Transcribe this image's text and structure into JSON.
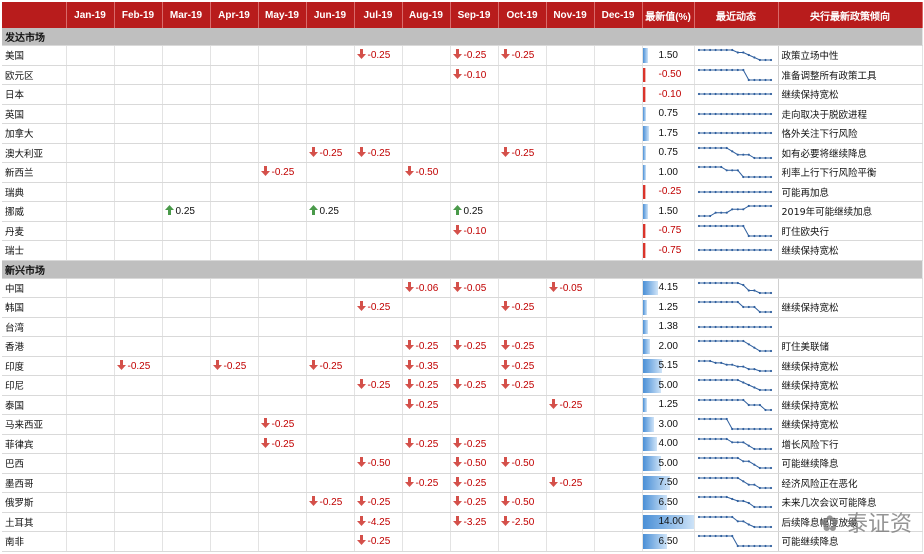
{
  "header": {
    "country": "",
    "months": [
      "Jan-19",
      "Feb-19",
      "Mar-19",
      "Apr-19",
      "May-19",
      "Jun-19",
      "Jul-19",
      "Aug-19",
      "Sep-19",
      "Oct-19",
      "Nov-19",
      "Dec-19"
    ],
    "latest": "最新值(%)",
    "trend": "最近动态",
    "note": "央行最新政策倾向"
  },
  "sections": [
    {
      "title": "发达市场",
      "rows": [
        {
          "country": "美国",
          "chg": {
            "Jul-19": "-0.25",
            "Sep-19": "-0.25",
            "Oct-19": "-0.25"
          },
          "latest": "1.50",
          "latest_num": 1.5,
          "note": "政策立场中性",
          "trend": [
            2.5,
            2.5,
            2.5,
            2.5,
            2.5,
            2.5,
            2.5,
            2.25,
            2.25,
            2.0,
            1.75,
            1.5,
            1.5,
            1.5
          ]
        },
        {
          "country": "欧元区",
          "chg": {
            "Sep-19": "-0.10"
          },
          "latest": "-0.50",
          "latest_num": -0.5,
          "note": "准备调整所有政策工具",
          "trend": [
            -0.4,
            -0.4,
            -0.4,
            -0.4,
            -0.4,
            -0.4,
            -0.4,
            -0.4,
            -0.4,
            -0.5,
            -0.5,
            -0.5,
            -0.5,
            -0.5
          ]
        },
        {
          "country": "日本",
          "chg": {},
          "latest": "-0.10",
          "latest_num": -0.1,
          "note": "继续保持宽松",
          "trend": [
            -0.1,
            -0.1,
            -0.1,
            -0.1,
            -0.1,
            -0.1,
            -0.1,
            -0.1,
            -0.1,
            -0.1,
            -0.1,
            -0.1,
            -0.1,
            -0.1
          ]
        },
        {
          "country": "英国",
          "chg": {},
          "latest": "0.75",
          "latest_num": 0.75,
          "note": "走向取决于脱欧进程",
          "trend": [
            0.75,
            0.75,
            0.75,
            0.75,
            0.75,
            0.75,
            0.75,
            0.75,
            0.75,
            0.75,
            0.75,
            0.75,
            0.75,
            0.75
          ]
        },
        {
          "country": "加拿大",
          "chg": {},
          "latest": "1.75",
          "latest_num": 1.75,
          "note": "恪外关注下行风险",
          "trend": [
            1.75,
            1.75,
            1.75,
            1.75,
            1.75,
            1.75,
            1.75,
            1.75,
            1.75,
            1.75,
            1.75,
            1.75,
            1.75,
            1.75
          ]
        },
        {
          "country": "澳大利亚",
          "chg": {
            "Jun-19": "-0.25",
            "Jul-19": "-0.25",
            "Oct-19": "-0.25"
          },
          "latest": "0.75",
          "latest_num": 0.75,
          "note": "如有必要将继续降息",
          "trend": [
            1.5,
            1.5,
            1.5,
            1.5,
            1.5,
            1.5,
            1.25,
            1.0,
            1.0,
            1.0,
            0.75,
            0.75,
            0.75,
            0.75
          ]
        },
        {
          "country": "新西兰",
          "chg": {
            "May-19": "-0.25",
            "Aug-19": "-0.50"
          },
          "latest": "1.00",
          "latest_num": 1.0,
          "note": "利率上行下行风险平衡",
          "trend": [
            1.75,
            1.75,
            1.75,
            1.75,
            1.75,
            1.5,
            1.5,
            1.5,
            1.0,
            1.0,
            1.0,
            1.0,
            1.0,
            1.0
          ]
        },
        {
          "country": "瑞典",
          "chg": {},
          "latest": "-0.25",
          "latest_num": -0.25,
          "note": "可能再加息",
          "trend": [
            -0.25,
            -0.25,
            -0.25,
            -0.25,
            -0.25,
            -0.25,
            -0.25,
            -0.25,
            -0.25,
            -0.25,
            -0.25,
            -0.25,
            -0.25,
            -0.25
          ]
        },
        {
          "country": "挪威",
          "chg": {
            "Mar-19": "0.25",
            "Jun-19": "0.25",
            "Sep-19": "0.25"
          },
          "latest": "1.50",
          "latest_num": 1.5,
          "note": "2019年可能继续加息",
          "trend": [
            0.75,
            0.75,
            0.75,
            1.0,
            1.0,
            1.0,
            1.25,
            1.25,
            1.25,
            1.5,
            1.5,
            1.5,
            1.5,
            1.5
          ]
        },
        {
          "country": "丹麦",
          "chg": {
            "Sep-19": "-0.10"
          },
          "latest": "-0.75",
          "latest_num": -0.75,
          "note": "盯住欧央行",
          "trend": [
            -0.65,
            -0.65,
            -0.65,
            -0.65,
            -0.65,
            -0.65,
            -0.65,
            -0.65,
            -0.65,
            -0.75,
            -0.75,
            -0.75,
            -0.75,
            -0.75
          ]
        },
        {
          "country": "瑞士",
          "chg": {},
          "latest": "-0.75",
          "latest_num": -0.75,
          "note": "继续保持宽松",
          "trend": [
            -0.75,
            -0.75,
            -0.75,
            -0.75,
            -0.75,
            -0.75,
            -0.75,
            -0.75,
            -0.75,
            -0.75,
            -0.75,
            -0.75,
            -0.75,
            -0.75
          ]
        }
      ]
    },
    {
      "title": "新兴市场",
      "rows": [
        {
          "country": "中国",
          "chg": {
            "Aug-19": "-0.06",
            "Sep-19": "-0.05",
            "Nov-19": "-0.05"
          },
          "latest": "4.15",
          "latest_num": 4.15,
          "note": "",
          "trend": [
            4.35,
            4.35,
            4.35,
            4.35,
            4.35,
            4.35,
            4.35,
            4.35,
            4.31,
            4.2,
            4.2,
            4.15,
            4.15,
            4.15
          ]
        },
        {
          "country": "韩国",
          "chg": {
            "Jul-19": "-0.25",
            "Oct-19": "-0.25"
          },
          "latest": "1.25",
          "latest_num": 1.25,
          "note": "继续保持宽松",
          "trend": [
            1.75,
            1.75,
            1.75,
            1.75,
            1.75,
            1.75,
            1.75,
            1.75,
            1.5,
            1.5,
            1.5,
            1.25,
            1.25,
            1.25
          ]
        },
        {
          "country": "台湾",
          "chg": {},
          "latest": "1.38",
          "latest_num": 1.38,
          "note": "",
          "trend": [
            1.38,
            1.38,
            1.38,
            1.38,
            1.38,
            1.38,
            1.38,
            1.38,
            1.38,
            1.38,
            1.38,
            1.38,
            1.38,
            1.38
          ]
        },
        {
          "country": "香港",
          "chg": {
            "Aug-19": "-0.25",
            "Sep-19": "-0.25",
            "Oct-19": "-0.25"
          },
          "latest": "2.00",
          "latest_num": 2.0,
          "note": "盯住美联储",
          "trend": [
            2.75,
            2.75,
            2.75,
            2.75,
            2.75,
            2.75,
            2.75,
            2.75,
            2.75,
            2.5,
            2.25,
            2.0,
            2.0,
            2.0
          ]
        },
        {
          "country": "印度",
          "chg": {
            "Feb-19": "-0.25",
            "Apr-19": "-0.25",
            "Jun-19": "-0.25",
            "Aug-19": "-0.35",
            "Oct-19": "-0.25"
          },
          "latest": "5.15",
          "latest_num": 5.15,
          "note": "继续保持宽松",
          "trend": [
            6.5,
            6.5,
            6.5,
            6.25,
            6.25,
            6.0,
            6.0,
            5.75,
            5.75,
            5.4,
            5.4,
            5.15,
            5.15,
            5.15
          ]
        },
        {
          "country": "印尼",
          "chg": {
            "Jul-19": "-0.25",
            "Aug-19": "-0.25",
            "Sep-19": "-0.25",
            "Oct-19": "-0.25"
          },
          "latest": "5.00",
          "latest_num": 5.0,
          "note": "继续保持宽松",
          "trend": [
            6.0,
            6.0,
            6.0,
            6.0,
            6.0,
            6.0,
            6.0,
            6.0,
            5.75,
            5.5,
            5.25,
            5.0,
            5.0,
            5.0
          ]
        },
        {
          "country": "泰国",
          "chg": {
            "Aug-19": "-0.25",
            "Nov-19": "-0.25"
          },
          "latest": "1.25",
          "latest_num": 1.25,
          "note": "继续保持宽松",
          "trend": [
            1.75,
            1.75,
            1.75,
            1.75,
            1.75,
            1.75,
            1.75,
            1.75,
            1.75,
            1.5,
            1.5,
            1.5,
            1.25,
            1.25
          ]
        },
        {
          "country": "马来西亚",
          "chg": {
            "May-19": "-0.25"
          },
          "latest": "3.00",
          "latest_num": 3.0,
          "note": "继续保持宽松",
          "trend": [
            3.25,
            3.25,
            3.25,
            3.25,
            3.25,
            3.25,
            3.0,
            3.0,
            3.0,
            3.0,
            3.0,
            3.0,
            3.0,
            3.0
          ]
        },
        {
          "country": "菲律宾",
          "chg": {
            "May-19": "-0.25",
            "Aug-19": "-0.25",
            "Sep-19": "-0.25"
          },
          "latest": "4.00",
          "latest_num": 4.0,
          "note": "增长风险下行",
          "trend": [
            4.75,
            4.75,
            4.75,
            4.75,
            4.75,
            4.75,
            4.5,
            4.5,
            4.5,
            4.25,
            4.0,
            4.0,
            4.0,
            4.0
          ]
        },
        {
          "country": "巴西",
          "chg": {
            "Jul-19": "-0.50",
            "Sep-19": "-0.50",
            "Oct-19": "-0.50"
          },
          "latest": "5.00",
          "latest_num": 5.0,
          "note": "可能继续降息",
          "trend": [
            6.5,
            6.5,
            6.5,
            6.5,
            6.5,
            6.5,
            6.5,
            6.5,
            6.0,
            6.0,
            5.5,
            5.0,
            5.0,
            5.0
          ]
        },
        {
          "country": "墨西哥",
          "chg": {
            "Aug-19": "-0.25",
            "Sep-19": "-0.25",
            "Nov-19": "-0.25"
          },
          "latest": "7.50",
          "latest_num": 7.5,
          "note": "经济风险正在恶化",
          "trend": [
            8.25,
            8.25,
            8.25,
            8.25,
            8.25,
            8.25,
            8.25,
            8.25,
            8.0,
            7.75,
            7.75,
            7.5,
            7.5,
            7.5
          ]
        },
        {
          "country": "俄罗斯",
          "chg": {
            "Jun-19": "-0.25",
            "Jul-19": "-0.25",
            "Sep-19": "-0.25",
            "Oct-19": "-0.50"
          },
          "latest": "6.50",
          "latest_num": 6.5,
          "note": "未来几次会议可能降息",
          "trend": [
            7.75,
            7.75,
            7.75,
            7.75,
            7.75,
            7.75,
            7.5,
            7.25,
            7.25,
            7.0,
            6.5,
            6.5,
            6.5,
            6.5
          ]
        },
        {
          "country": "土耳其",
          "chg": {
            "Jul-19": "-4.25",
            "Sep-19": "-3.25",
            "Oct-19": "-2.50"
          },
          "latest": "14.00",
          "latest_num": 14.0,
          "note": "后续降息幅度放缓",
          "trend": [
            24,
            24,
            24,
            24,
            24,
            24,
            24,
            19.75,
            19.75,
            16.5,
            14,
            14,
            14,
            14
          ]
        },
        {
          "country": "南非",
          "chg": {
            "Jul-19": "-0.25"
          },
          "latest": "6.50",
          "latest_num": 6.5,
          "note": "可能继续降息",
          "trend": [
            6.75,
            6.75,
            6.75,
            6.75,
            6.75,
            6.75,
            6.75,
            6.5,
            6.5,
            6.5,
            6.5,
            6.5,
            6.5,
            6.5
          ]
        }
      ]
    }
  ],
  "watermark": "泰证资"
}
